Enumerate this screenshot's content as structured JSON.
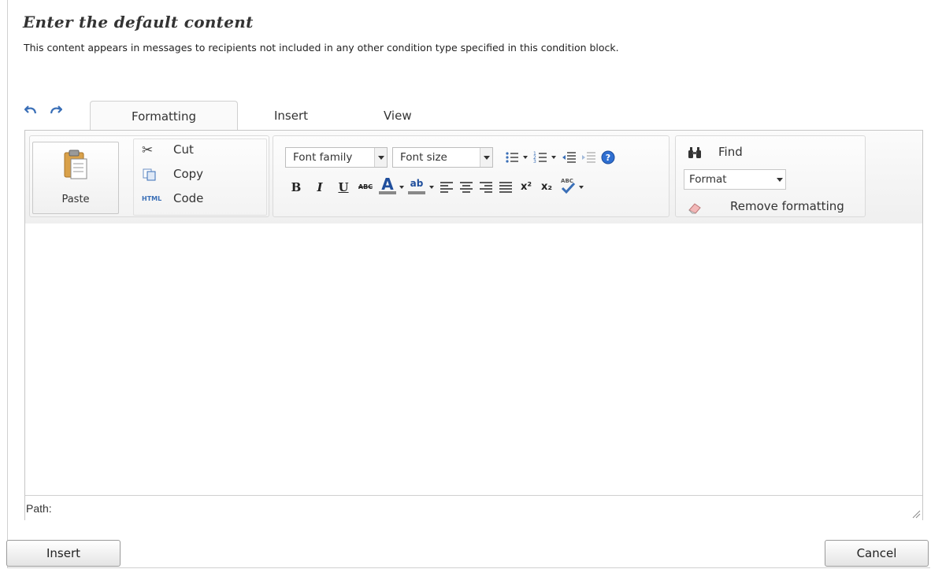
{
  "header": {
    "title": "Enter the default content",
    "description": "This content appears in messages to recipients not included in any other condition type specified in this condition block."
  },
  "tabs": [
    {
      "label": "Formatting",
      "active": true
    },
    {
      "label": "Insert",
      "active": false
    },
    {
      "label": "View",
      "active": false
    }
  ],
  "clipboard": {
    "paste_label": "Paste",
    "cut_label": "Cut",
    "copy_label": "Copy",
    "code_label": "Code",
    "code_icon_text": "HTML"
  },
  "font": {
    "family_value": "Font family",
    "size_value": "Font size"
  },
  "format_buttons": {
    "bold": "B",
    "italic": "I",
    "underline": "U",
    "strike": "ABC",
    "font_color": "A",
    "highlight": "ab",
    "superscript": "x²",
    "subscript": "x₂",
    "spellcheck": "ABC"
  },
  "editing": {
    "find_label": "Find",
    "format_value": "Format",
    "remove_formatting_label": "Remove formatting"
  },
  "statusbar": {
    "path_label": "Path:"
  },
  "footer": {
    "insert_label": "Insert",
    "cancel_label": "Cancel"
  },
  "colors": {
    "accent_blue": "#3a6fb7",
    "font_color_bar": "#1f4e9c",
    "highlight_bar": "#8c8c8c",
    "border": "#c6c6c6"
  }
}
